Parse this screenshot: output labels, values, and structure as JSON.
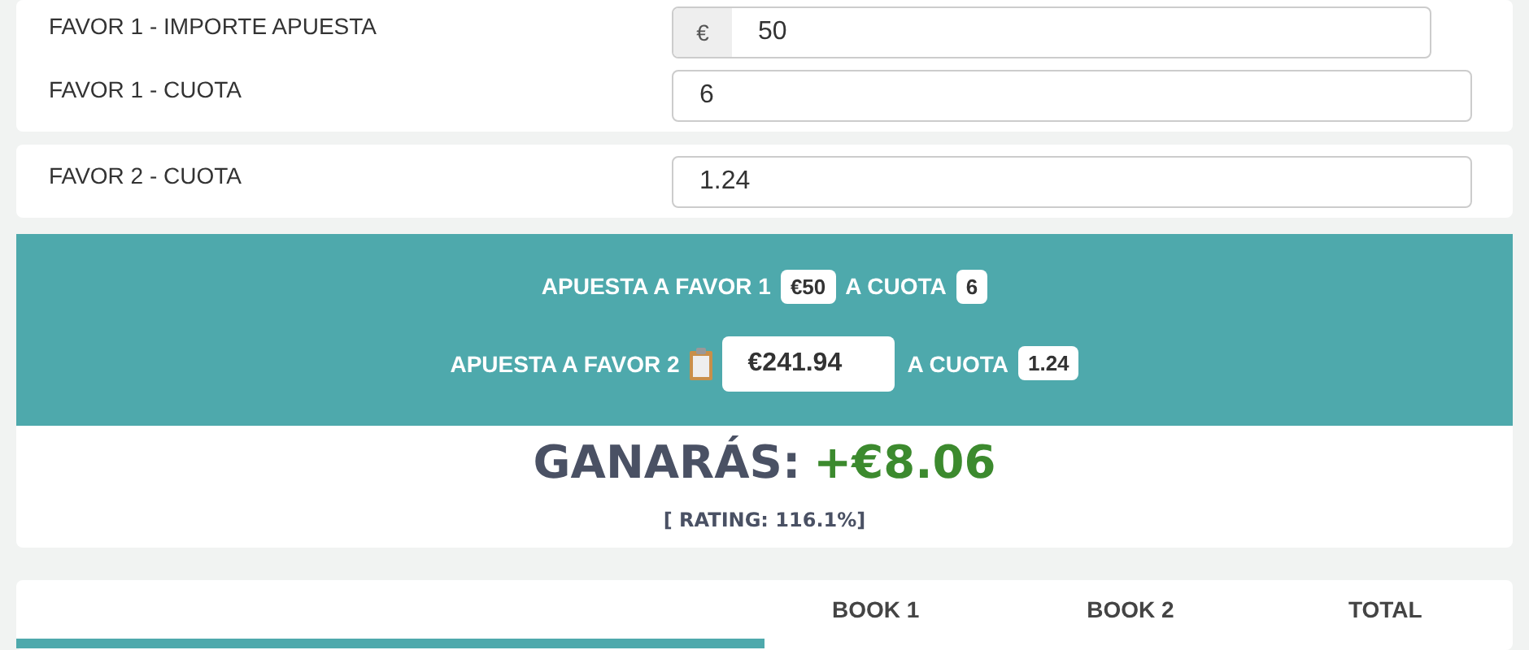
{
  "cards": [
    {
      "rows": [
        {
          "label": "FAVOR 1 - IMPORTE APUESTA",
          "prefix": "€",
          "value": "50"
        },
        {
          "label": "FAVOR 1 - CUOTA",
          "value": "6"
        }
      ]
    },
    {
      "rows": [
        {
          "label": "FAVOR 2 - CUOTA",
          "value": "1.24"
        }
      ]
    }
  ],
  "result": {
    "bets": [
      {
        "label": "APUESTA A FAVOR 1",
        "amount": "€50",
        "kind": "badge",
        "odds_label": "A CUOTA",
        "odds": "6"
      },
      {
        "label": "APUESTA A FAVOR 2",
        "amount": "€241.94",
        "kind": "field",
        "odds_label": "A CUOTA",
        "odds": "1.24"
      }
    ],
    "profit_label": "GANARÁS:",
    "profit": "+€8.06",
    "rating": "[ RATING: 116.1%]"
  },
  "table": {
    "columns": [
      "BOOK 1",
      "BOOK 2",
      "TOTAL"
    ]
  }
}
